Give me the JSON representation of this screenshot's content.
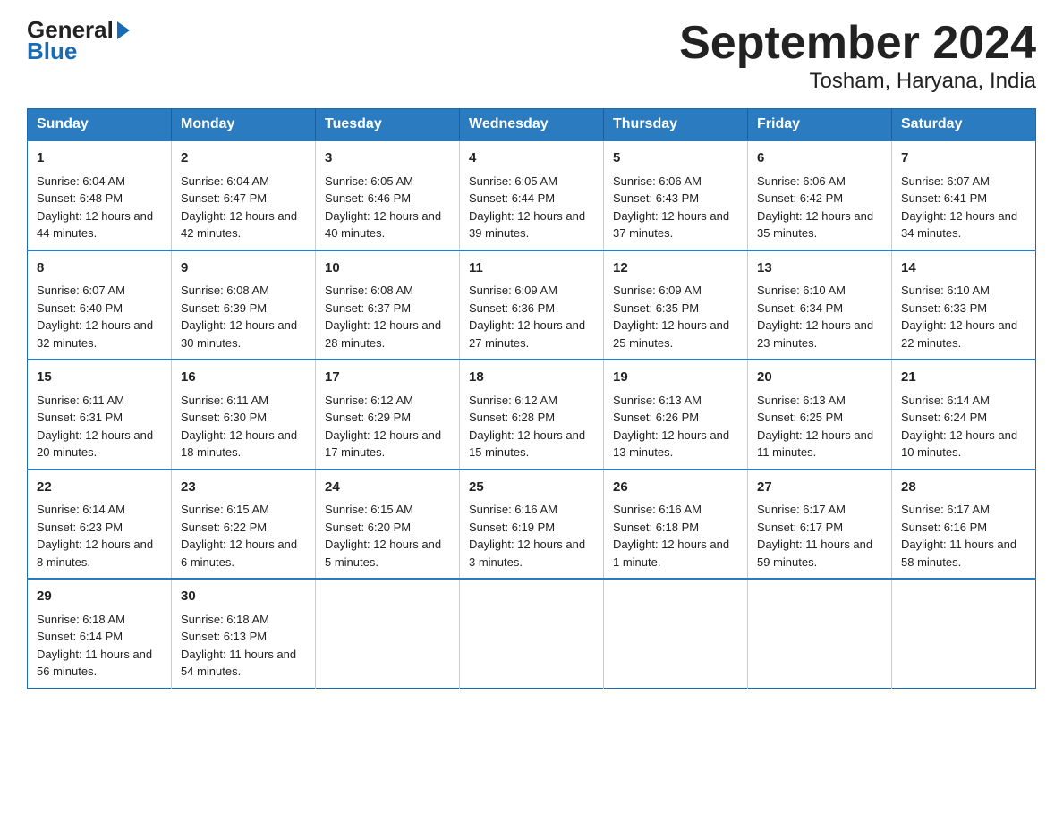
{
  "header": {
    "logo_general": "General",
    "logo_blue": "Blue",
    "title": "September 2024",
    "subtitle": "Tosham, Haryana, India"
  },
  "days_of_week": [
    "Sunday",
    "Monday",
    "Tuesday",
    "Wednesday",
    "Thursday",
    "Friday",
    "Saturday"
  ],
  "weeks": [
    [
      {
        "day": "1",
        "sunrise": "6:04 AM",
        "sunset": "6:48 PM",
        "daylight": "12 hours and 44 minutes."
      },
      {
        "day": "2",
        "sunrise": "6:04 AM",
        "sunset": "6:47 PM",
        "daylight": "12 hours and 42 minutes."
      },
      {
        "day": "3",
        "sunrise": "6:05 AM",
        "sunset": "6:46 PM",
        "daylight": "12 hours and 40 minutes."
      },
      {
        "day": "4",
        "sunrise": "6:05 AM",
        "sunset": "6:44 PM",
        "daylight": "12 hours and 39 minutes."
      },
      {
        "day": "5",
        "sunrise": "6:06 AM",
        "sunset": "6:43 PM",
        "daylight": "12 hours and 37 minutes."
      },
      {
        "day": "6",
        "sunrise": "6:06 AM",
        "sunset": "6:42 PM",
        "daylight": "12 hours and 35 minutes."
      },
      {
        "day": "7",
        "sunrise": "6:07 AM",
        "sunset": "6:41 PM",
        "daylight": "12 hours and 34 minutes."
      }
    ],
    [
      {
        "day": "8",
        "sunrise": "6:07 AM",
        "sunset": "6:40 PM",
        "daylight": "12 hours and 32 minutes."
      },
      {
        "day": "9",
        "sunrise": "6:08 AM",
        "sunset": "6:39 PM",
        "daylight": "12 hours and 30 minutes."
      },
      {
        "day": "10",
        "sunrise": "6:08 AM",
        "sunset": "6:37 PM",
        "daylight": "12 hours and 28 minutes."
      },
      {
        "day": "11",
        "sunrise": "6:09 AM",
        "sunset": "6:36 PM",
        "daylight": "12 hours and 27 minutes."
      },
      {
        "day": "12",
        "sunrise": "6:09 AM",
        "sunset": "6:35 PM",
        "daylight": "12 hours and 25 minutes."
      },
      {
        "day": "13",
        "sunrise": "6:10 AM",
        "sunset": "6:34 PM",
        "daylight": "12 hours and 23 minutes."
      },
      {
        "day": "14",
        "sunrise": "6:10 AM",
        "sunset": "6:33 PM",
        "daylight": "12 hours and 22 minutes."
      }
    ],
    [
      {
        "day": "15",
        "sunrise": "6:11 AM",
        "sunset": "6:31 PM",
        "daylight": "12 hours and 20 minutes."
      },
      {
        "day": "16",
        "sunrise": "6:11 AM",
        "sunset": "6:30 PM",
        "daylight": "12 hours and 18 minutes."
      },
      {
        "day": "17",
        "sunrise": "6:12 AM",
        "sunset": "6:29 PM",
        "daylight": "12 hours and 17 minutes."
      },
      {
        "day": "18",
        "sunrise": "6:12 AM",
        "sunset": "6:28 PM",
        "daylight": "12 hours and 15 minutes."
      },
      {
        "day": "19",
        "sunrise": "6:13 AM",
        "sunset": "6:26 PM",
        "daylight": "12 hours and 13 minutes."
      },
      {
        "day": "20",
        "sunrise": "6:13 AM",
        "sunset": "6:25 PM",
        "daylight": "12 hours and 11 minutes."
      },
      {
        "day": "21",
        "sunrise": "6:14 AM",
        "sunset": "6:24 PM",
        "daylight": "12 hours and 10 minutes."
      }
    ],
    [
      {
        "day": "22",
        "sunrise": "6:14 AM",
        "sunset": "6:23 PM",
        "daylight": "12 hours and 8 minutes."
      },
      {
        "day": "23",
        "sunrise": "6:15 AM",
        "sunset": "6:22 PM",
        "daylight": "12 hours and 6 minutes."
      },
      {
        "day": "24",
        "sunrise": "6:15 AM",
        "sunset": "6:20 PM",
        "daylight": "12 hours and 5 minutes."
      },
      {
        "day": "25",
        "sunrise": "6:16 AM",
        "sunset": "6:19 PM",
        "daylight": "12 hours and 3 minutes."
      },
      {
        "day": "26",
        "sunrise": "6:16 AM",
        "sunset": "6:18 PM",
        "daylight": "12 hours and 1 minute."
      },
      {
        "day": "27",
        "sunrise": "6:17 AM",
        "sunset": "6:17 PM",
        "daylight": "11 hours and 59 minutes."
      },
      {
        "day": "28",
        "sunrise": "6:17 AM",
        "sunset": "6:16 PM",
        "daylight": "11 hours and 58 minutes."
      }
    ],
    [
      {
        "day": "29",
        "sunrise": "6:18 AM",
        "sunset": "6:14 PM",
        "daylight": "11 hours and 56 minutes."
      },
      {
        "day": "30",
        "sunrise": "6:18 AM",
        "sunset": "6:13 PM",
        "daylight": "11 hours and 54 minutes."
      },
      null,
      null,
      null,
      null,
      null
    ]
  ]
}
